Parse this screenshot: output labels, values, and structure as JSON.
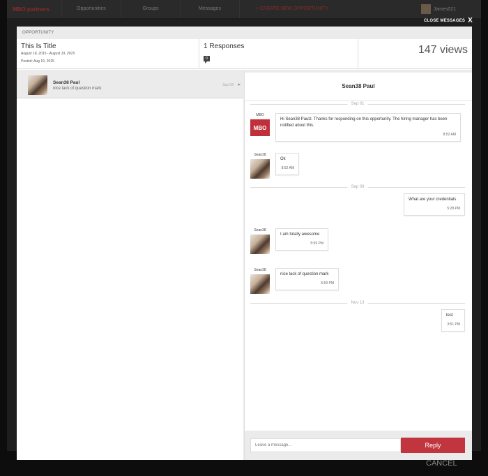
{
  "background": {
    "logo": "MBO partners",
    "nav_items": [
      "Opportunities",
      "Groups",
      "Messages"
    ],
    "create_label": "+ CREATE NEW OPPORTUNITY",
    "user_name": "James021",
    "cancel_label": "CANCEL"
  },
  "close_label": "CLOSE MESSAGES",
  "close_icon": "X",
  "modal": {
    "header": "OPPORTUNITY",
    "title": "This Is Title",
    "dates": "August 18, 2015 - August 19, 2015",
    "posted": "Posted: Aug 19, 2015",
    "responses_label": "1 Responses",
    "responses_badge": "0",
    "views": "147 views"
  },
  "responses": [
    {
      "name": "Sean38 Paul",
      "preview": "nice lack of question mark",
      "date": "Sep 09",
      "arrow": "▸"
    }
  ],
  "chat": {
    "title": "Sean38 Paul",
    "dividers": [
      "Sep 01",
      "Sep 09",
      "Nov 13"
    ],
    "messages": [
      {
        "sender": "MBO",
        "logo": "MBO",
        "text": "Hi Sean38 Paulz. Thanks for responding on this opportunity. The hiring manager has been notified about this.",
        "time": "8:52 AM"
      },
      {
        "sender": "Sean38",
        "text": "Ok",
        "time": "8:52 AM"
      },
      {
        "text": "What are your credentials",
        "time": "5:28 PM"
      },
      {
        "sender": "Sean38",
        "text": "I am totally awesome",
        "time": "5:59 PM"
      },
      {
        "sender": "Sean38",
        "text": "nice lack of question mark",
        "time": "5:59 PM"
      },
      {
        "text": "test",
        "time": "3:51 PM"
      }
    ],
    "input_placeholder": "Leave a message...",
    "reply_label": "Reply"
  },
  "colors": {
    "accent": "#c1353f",
    "panel": "#ebebeb"
  }
}
